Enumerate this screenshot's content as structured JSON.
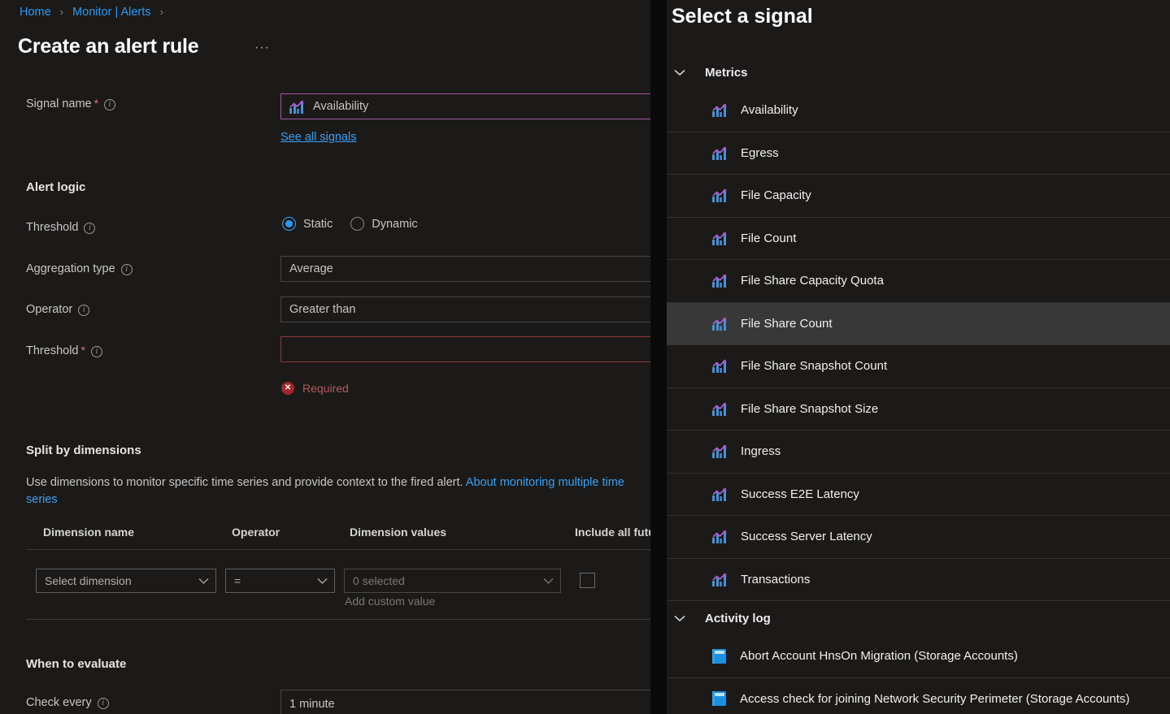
{
  "breadcrumb": {
    "items": [
      "Home",
      "Monitor | Alerts"
    ],
    "separator": "›"
  },
  "header": {
    "title": "Create an alert rule",
    "more_label": "···"
  },
  "form": {
    "signal_name_label": "Signal name",
    "signal_name_value": "Availability",
    "signal_name_icon": "metric-chart-icon",
    "see_all_signals": "See all signals",
    "alert_logic_heading": "Alert logic",
    "threshold_label": "Threshold",
    "threshold_static": "Static",
    "threshold_dynamic": "Dynamic",
    "threshold_selected": "Static",
    "aggregation_label": "Aggregation type",
    "aggregation_value": "Average",
    "operator_label": "Operator",
    "operator_value": "Greater than",
    "threshold_value_label": "Threshold",
    "threshold_value": "",
    "threshold_error": "Required",
    "error_icon": "✕"
  },
  "split": {
    "heading": "Split by dimensions",
    "description": "Use dimensions to monitor specific time series and provide context to the fired alert.",
    "link_text": "About monitoring multiple time series",
    "columns": [
      "Dimension name",
      "Operator",
      "Dimension values",
      "Include all future values"
    ],
    "row": {
      "dimension_name": "Select dimension",
      "operator": "=",
      "dimension_values": "0 selected",
      "add_custom_value": "Add custom value",
      "include_all_checked": false
    }
  },
  "evaluate": {
    "heading": "When to evaluate",
    "check_every_label": "Check every",
    "check_every_value": "1 minute"
  },
  "signal_panel": {
    "title": "Select a signal",
    "groups": [
      {
        "name": "Metrics",
        "expanded": true,
        "chevron": "chevron-down-icon",
        "icon_type": "metric",
        "items": [
          {
            "label": "Availability",
            "hovered": false
          },
          {
            "label": "Egress",
            "hovered": false
          },
          {
            "label": "File Capacity",
            "hovered": false
          },
          {
            "label": "File Count",
            "hovered": false
          },
          {
            "label": "File Share Capacity Quota",
            "hovered": false
          },
          {
            "label": "File Share Count",
            "hovered": true
          },
          {
            "label": "File Share Snapshot Count",
            "hovered": false
          },
          {
            "label": "File Share Snapshot Size",
            "hovered": false
          },
          {
            "label": "Ingress",
            "hovered": false
          },
          {
            "label": "Success E2E Latency",
            "hovered": false
          },
          {
            "label": "Success Server Latency",
            "hovered": false
          },
          {
            "label": "Transactions",
            "hovered": false
          }
        ]
      },
      {
        "name": "Activity log",
        "expanded": true,
        "chevron": "chevron-down-icon",
        "icon_type": "log",
        "items": [
          {
            "label": "Abort Account HnsOn Migration (Storage Accounts)",
            "hovered": false
          },
          {
            "label": "Access check for joining Network Security Perimeter (Storage Accounts)",
            "hovered": false
          }
        ]
      }
    ]
  },
  "colors": {
    "panel_bg": "#1b1a19",
    "accent_blue": "#2899f5",
    "link_blue": "#3aa0f3",
    "focus_purple": "#a4559f",
    "error_red": "#a4262c",
    "hover_row": "#383838"
  }
}
